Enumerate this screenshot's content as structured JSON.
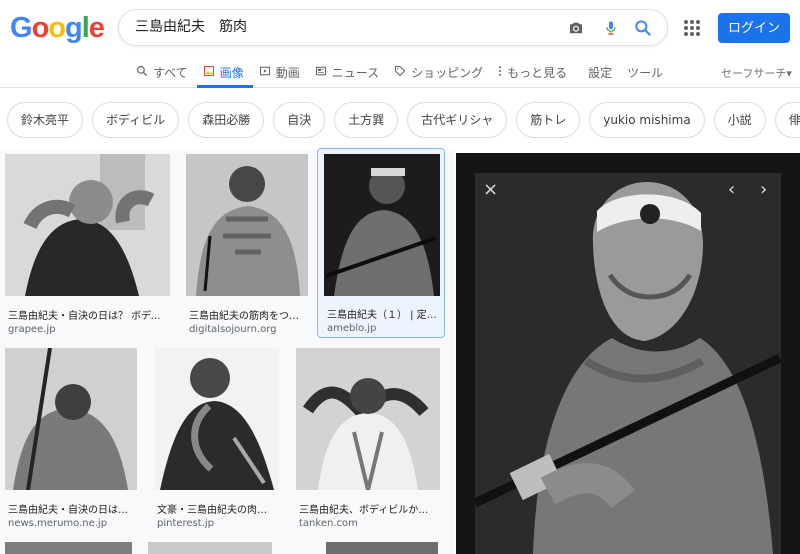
{
  "logo": {
    "letters": [
      "G",
      "o",
      "o",
      "g",
      "l",
      "e"
    ],
    "colors": [
      "#4285f4",
      "#ea4335",
      "#fbbc05",
      "#4285f4",
      "#34a853",
      "#ea4335"
    ]
  },
  "search": {
    "query": "三島由紀夫　筋肉",
    "icons": [
      "camera-icon",
      "mic-icon",
      "search-icon"
    ]
  },
  "header": {
    "login_label": "ログイン",
    "apps_icon": "apps-grid-icon"
  },
  "nav": {
    "tabs": [
      "すべて",
      "画像",
      "動画",
      "ニュース",
      "ショッピング",
      "もっと見る",
      "設定",
      "ツール"
    ],
    "safe_search": "セーフサーチ▾"
  },
  "chips": [
    "鈴木亮平",
    "ボディビル",
    "森田必勝",
    "自決",
    "土方巽",
    "古代ギリシャ",
    "筋トレ",
    "yukio mishima",
    "小説",
    "俳優"
  ],
  "results": [
    {
      "title": "三島由紀夫・自決の日は？ ボディ…",
      "site": "grapee.jp"
    },
    {
      "title": "三島由紀夫の筋肉をつけ…",
      "site": "digitalsojourn.org"
    },
    {
      "title": "三島由紀夫（１） | 定…",
      "site": "ameblo.jp"
    },
    {
      "title": "三島由紀夫・自決の日は？…",
      "site": "news.merumo.ne.jp"
    },
    {
      "title": "文豪・三島由紀夫の肉体…",
      "site": "pinterest.jp"
    },
    {
      "title": "三島由紀夫、ボディビルから…",
      "site": "tanken.com"
    }
  ],
  "preview": {
    "close": "×",
    "prev": "‹",
    "next": "›"
  }
}
